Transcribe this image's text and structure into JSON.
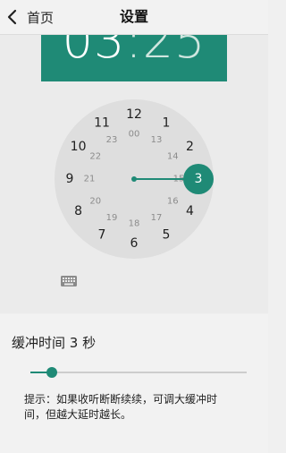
{
  "header": {
    "back_label": "首页",
    "title": "设置"
  },
  "time_picker": {
    "hour": "03",
    "separator": ":",
    "minute": "25",
    "outer_hours": [
      "12",
      "1",
      "2",
      "3",
      "4",
      "5",
      "6",
      "7",
      "8",
      "9",
      "10",
      "11"
    ],
    "inner_hours": [
      "00",
      "13",
      "14",
      "15",
      "16",
      "17",
      "18",
      "19",
      "20",
      "21",
      "22",
      "23"
    ],
    "selected_hour": "3",
    "accent_color": "#1f8a76",
    "keyboard_icon": "keyboard-icon"
  },
  "buffer": {
    "title": "缓冲时间 3 秒",
    "slider_fraction": 0.1,
    "hint_line1": "提示：如果收听断断续续，可调大缓冲时",
    "hint_line2": "间，但越大延时越长。"
  }
}
